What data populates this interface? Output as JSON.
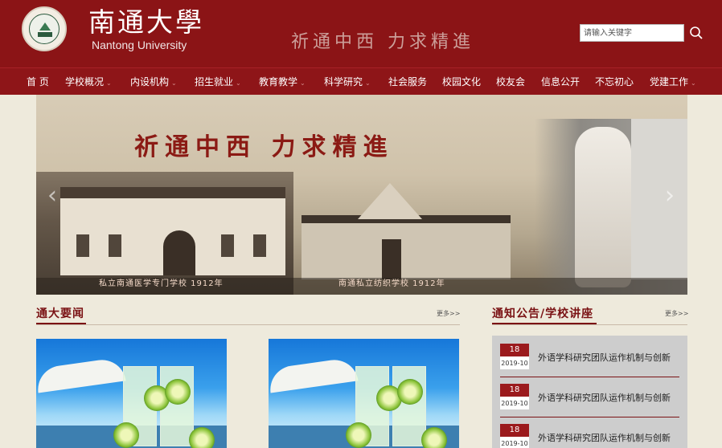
{
  "header": {
    "logo_cn": "南通大學",
    "logo_en": "Nantong University",
    "motto": "祈通中西 力求精進",
    "search_placeholder": "请输入关键字"
  },
  "nav": {
    "items": [
      {
        "label": "首 页",
        "has_dropdown": false
      },
      {
        "label": "学校概况",
        "has_dropdown": true
      },
      {
        "label": "内设机构",
        "has_dropdown": true
      },
      {
        "label": "招生就业",
        "has_dropdown": true
      },
      {
        "label": "教育教学",
        "has_dropdown": true
      },
      {
        "label": "科学研究",
        "has_dropdown": true
      },
      {
        "label": "社会服务",
        "has_dropdown": false
      },
      {
        "label": "校园文化",
        "has_dropdown": false
      },
      {
        "label": "校友会",
        "has_dropdown": false
      },
      {
        "label": "信息公开",
        "has_dropdown": false
      },
      {
        "label": "不忘初心",
        "has_dropdown": false
      },
      {
        "label": "党建工作",
        "has_dropdown": true
      }
    ]
  },
  "banner": {
    "motto": "祈通中西 力求精進",
    "caption_left": "私立南通医学专门学校 1912年",
    "caption_right": "南通私立纺织学校 1912年",
    "prev": "‹",
    "next": "›"
  },
  "news": {
    "title": "通大要闻",
    "more": "更多>>"
  },
  "notices": {
    "title": "通知公告/学校讲座",
    "more": "更多>>",
    "items": [
      {
        "day": "18",
        "ym": "2019-10",
        "title": "外语学科研究团队运作机制与创新"
      },
      {
        "day": "18",
        "ym": "2019-10",
        "title": "外语学科研究团队运作机制与创新"
      },
      {
        "day": "18",
        "ym": "2019-10",
        "title": "外语学科研究团队运作机制与创新"
      }
    ]
  },
  "colors": {
    "brand_red": "#8b1416",
    "page_bg": "#eeeadc"
  }
}
